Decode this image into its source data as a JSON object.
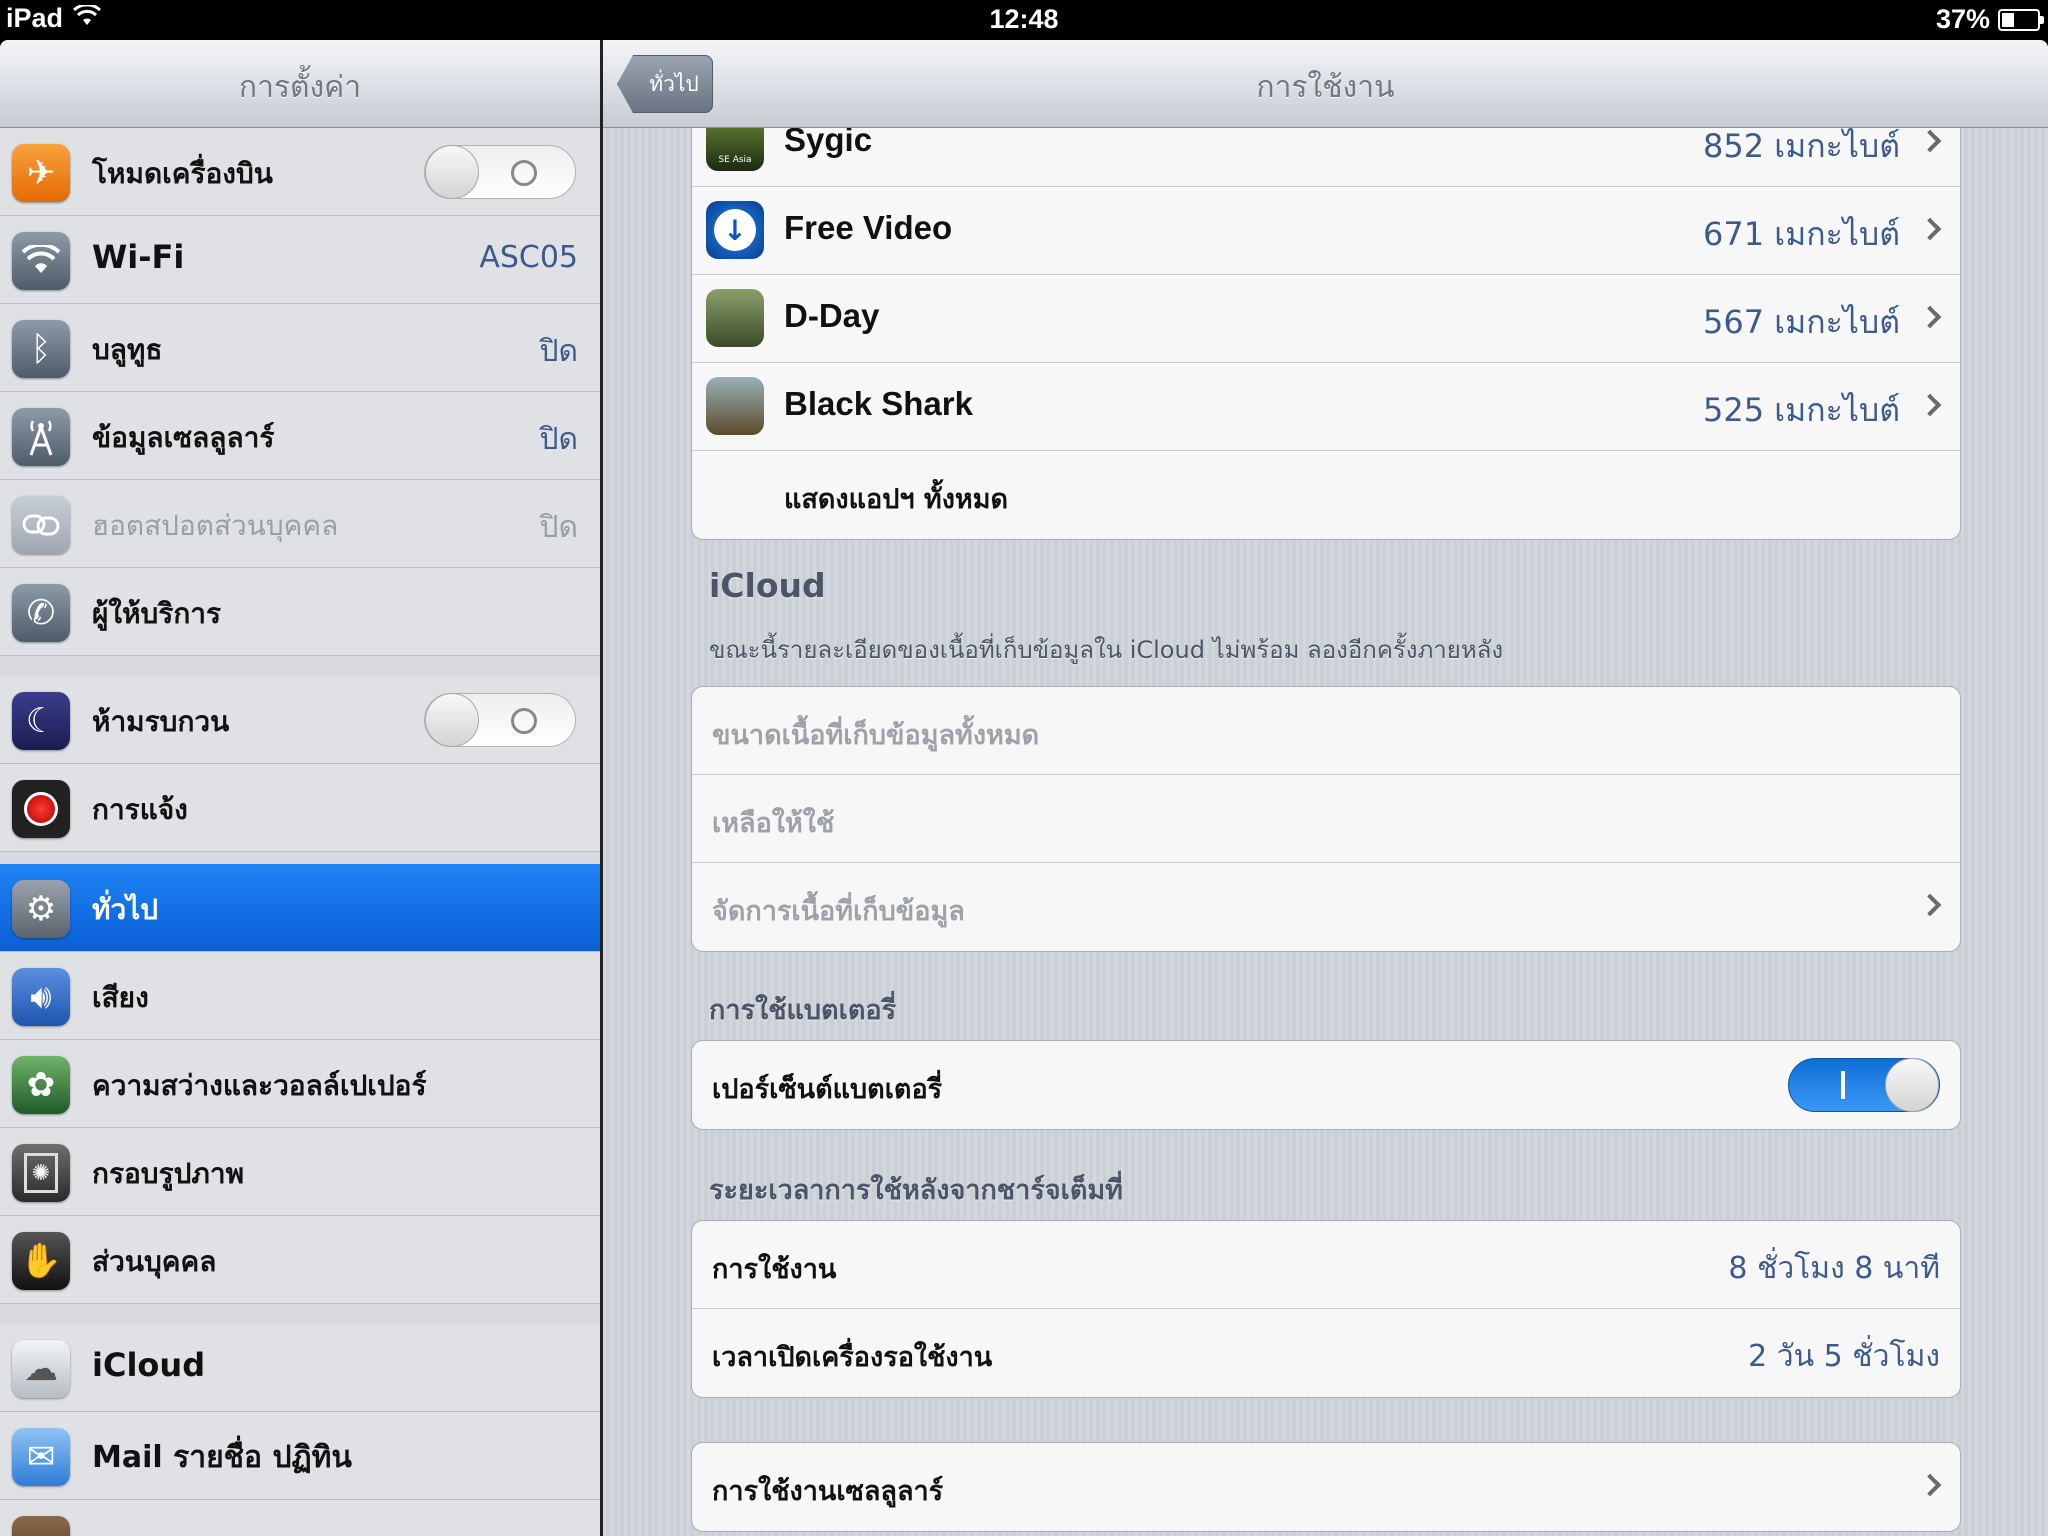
{
  "status_bar": {
    "device": "iPad",
    "time": "12:48",
    "battery": "37%"
  },
  "master": {
    "title": "การตั้งค่า",
    "items": [
      {
        "label": "โหมดเครื่องบิน",
        "icon": "airplane-icon",
        "toggle": false
      },
      {
        "label": "Wi-Fi",
        "icon": "wifi-icon",
        "value": "ASC05"
      },
      {
        "label": "บลูทูธ",
        "icon": "bluetooth-icon",
        "value": "ปิด"
      },
      {
        "label": "ข้อมูลเซลลูลาร์",
        "icon": "cellular-icon",
        "value": "ปิด"
      },
      {
        "label": "ฮอตสปอตส่วนบุคคล",
        "icon": "hotspot-icon",
        "value": "ปิด"
      },
      {
        "label": "ผู้ให้บริการ",
        "icon": "phone-icon"
      },
      {
        "label": "ห้ามรบกวน",
        "icon": "moon-icon",
        "toggle": false
      },
      {
        "label": "การแจ้ง",
        "icon": "notifications-icon"
      },
      {
        "label": "ทั่วไป",
        "icon": "gear-icon"
      },
      {
        "label": "เสียง",
        "icon": "speaker-icon"
      },
      {
        "label": "ความสว่างและวอลล์เปเปอร์",
        "icon": "flower-icon"
      },
      {
        "label": "กรอบรูปภาพ",
        "icon": "picture-frame-icon"
      },
      {
        "label": "ส่วนบุคคล",
        "icon": "hand-icon"
      },
      {
        "label": "iCloud",
        "icon": "icloud-icon"
      },
      {
        "label": "Mail รายชื่อ ปฏิทิน",
        "icon": "mail-icon"
      }
    ]
  },
  "detail": {
    "back_label": "ทั่วไป",
    "title": "การใช้งาน",
    "apps": [
      {
        "name": "Sygic",
        "size": "852 เมกะไบต์",
        "icon_text": "SE Asia"
      },
      {
        "name": "Free Video",
        "size": "671 เมกะไบต์"
      },
      {
        "name": "D-Day",
        "size": "567 เมกะไบต์"
      },
      {
        "name": "Black Shark",
        "size": "525 เมกะไบต์"
      }
    ],
    "show_all": "แสดงแอปฯ ทั้งหมด",
    "icloud": {
      "title": "iCloud",
      "note": "ขณะนี้รายละเอียดของเนื้อที่เก็บข้อมูลใน iCloud ไม่พร้อม ลองอีกครั้งภายหลัง",
      "rows": [
        "ขนาดเนื้อที่เก็บข้อมูลทั้งหมด",
        "เหลือให้ใช้",
        "จัดการเนื้อที่เก็บข้อมูล"
      ]
    },
    "battery_usage": {
      "title": "การใช้แบตเตอรี่",
      "percent_label": "เปอร์เซ็นต์แบตเตอรี่",
      "percent_on": true
    },
    "time_since_charge": {
      "title": "ระยะเวลาการใช้หลังจากชาร์จเต็มที่",
      "usage_label": "การใช้งาน",
      "usage_value": "8 ชั่วโมง 8 นาที",
      "standby_label": "เวลาเปิดเครื่องรอใช้งาน",
      "standby_value": "2 วัน 5 ชั่วโมง"
    },
    "cellular_usage": "การใช้งานเซลลูลาร์"
  }
}
